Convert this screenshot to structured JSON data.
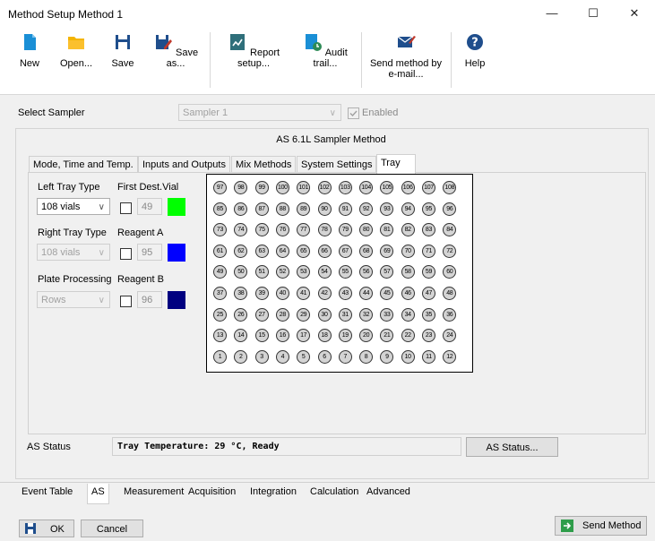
{
  "window": {
    "title": "Method Setup Method 1",
    "minimize": "—",
    "maximize": "☐",
    "close": "✕"
  },
  "ribbon": {
    "new": "New",
    "open": "Open...",
    "save": "Save",
    "save_as": "Save as...",
    "report_setup": "Report setup...",
    "audit_trail": "Audit trail...",
    "send_method_line1": "Send method by",
    "send_method_line2": "e-mail...",
    "help": "Help",
    "colors": {
      "new": "#1a8fd6",
      "open": "#f4b400",
      "save": "#1f4e8c",
      "audit": "#2e8b57",
      "help": "#1f4e8c"
    }
  },
  "sampler": {
    "label": "Select Sampler",
    "value": "Sampler 1",
    "enabled_label": "Enabled"
  },
  "method": {
    "title": "AS 6.1L Sampler Method",
    "tabs": [
      "Mode, Time and Temp.",
      "Inputs and Outputs",
      "Mix Methods",
      "System Settings",
      "Tray"
    ],
    "selected_tab": "Tray"
  },
  "tray_settings": {
    "left_tray_type_label": "Left Tray Type",
    "left_tray_type": "108 vials",
    "right_tray_type_label": "Right Tray Type",
    "right_tray_type": "108 vials",
    "plate_processing_label": "Plate Processing",
    "plate_processing": "Rows",
    "first_dest_label": "First Dest.Vial",
    "first_dest_value": "49",
    "first_dest_color": "#00ff00",
    "reagent_a_label": "Reagent A",
    "reagent_a_value": "95",
    "reagent_a_color": "#0000ff",
    "reagent_b_label": "Reagent B",
    "reagent_b_value": "96",
    "reagent_b_color": "#000080"
  },
  "tray": {
    "rows": 9,
    "cols": 12
  },
  "status": {
    "label": "AS Status",
    "text": "Tray Temperature: 29 °C, Ready",
    "button": "AS Status..."
  },
  "bottom_tabs": [
    "Event Table",
    "AS",
    "Measurement",
    "Acquisition",
    "Integration",
    "Calculation",
    "Advanced"
  ],
  "bottom_selected": "AS",
  "footer": {
    "ok": "OK",
    "cancel": "Cancel",
    "send_method": "Send Method"
  }
}
